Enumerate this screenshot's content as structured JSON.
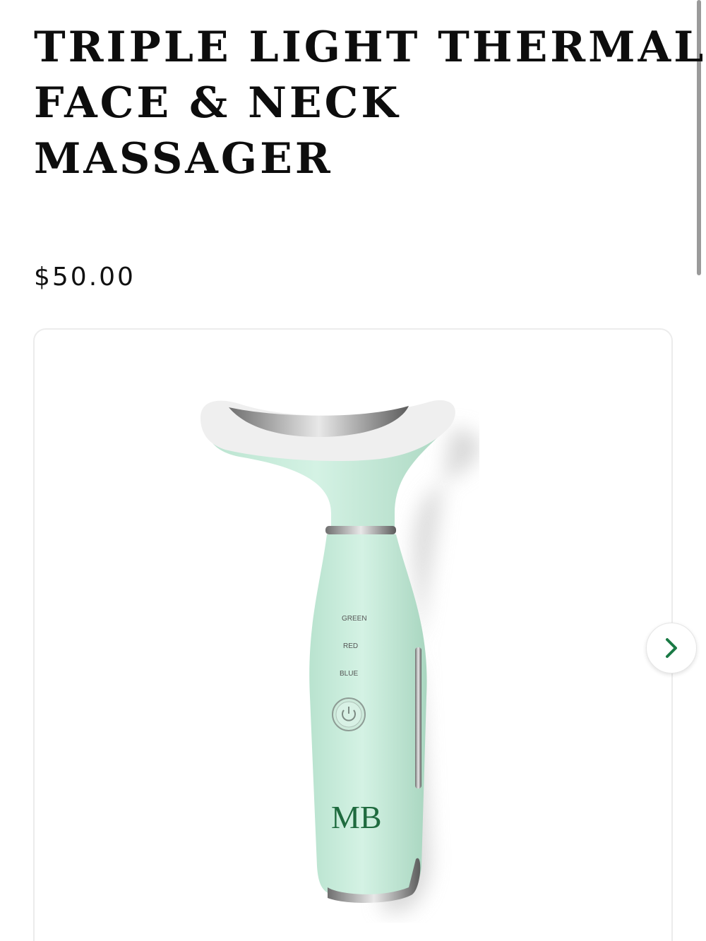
{
  "product": {
    "title_lines": [
      "TRIPLE LIGHT THERMAL",
      "FACE & NECK",
      "MASSAGER"
    ],
    "price": "$50.00",
    "image": {
      "alt": "",
      "device_labels": [
        "GREEN",
        "RED",
        "BLUE"
      ],
      "logo_text": "MB"
    }
  },
  "gallery": {
    "next_icon": "chevron-right-icon"
  },
  "colors": {
    "device_body": "#c8ecdc",
    "logo_green": "#1f6b3f",
    "chevron_green": "#1a7a45",
    "text": "#111111"
  }
}
